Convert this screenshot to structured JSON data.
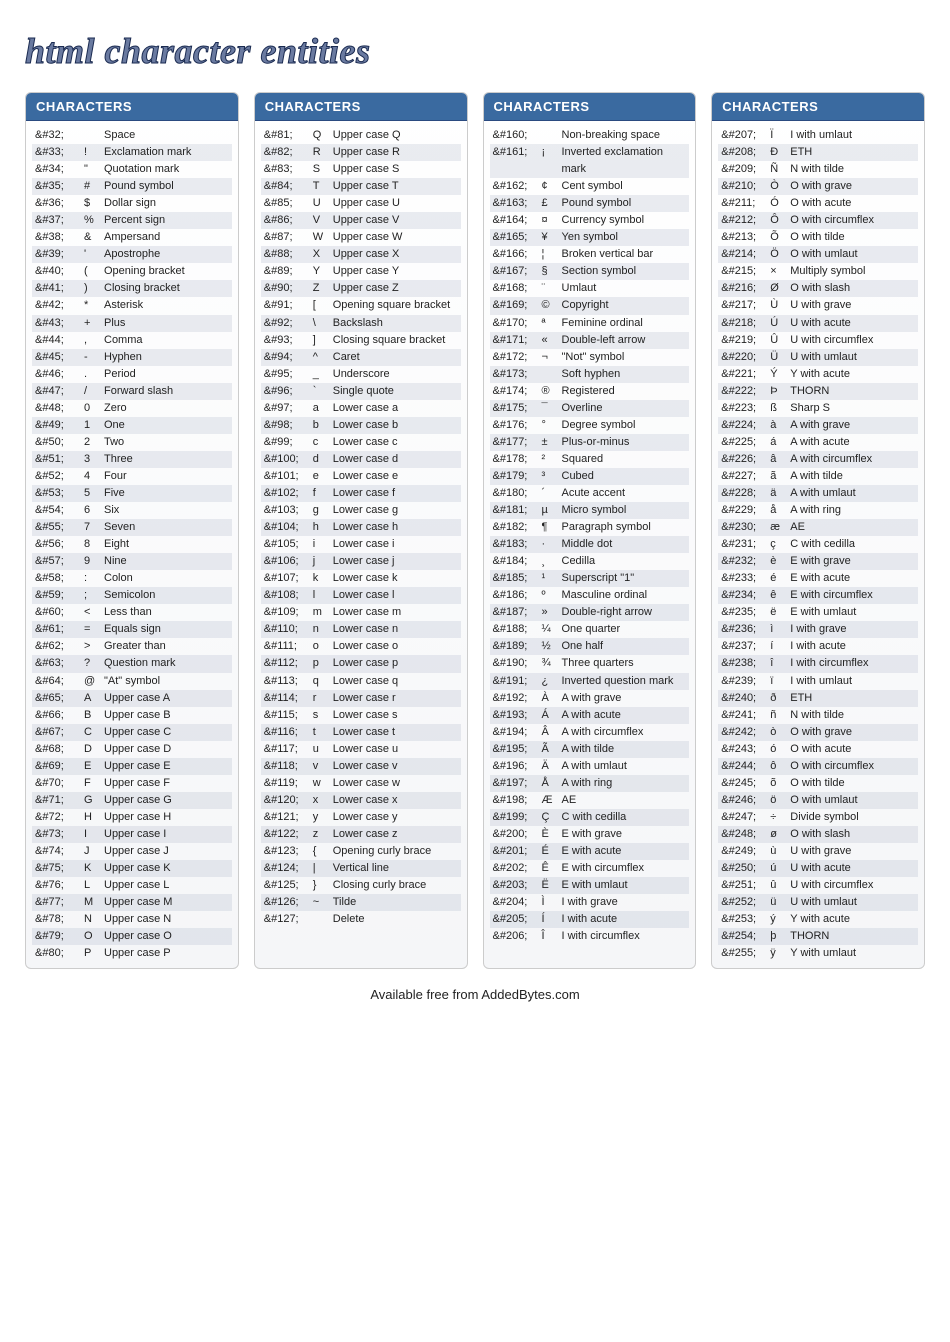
{
  "title": "html character entities",
  "col_header": "CHARACTERS",
  "footer": "Available free from AddedBytes.com",
  "columns": [
    [
      {
        "code": "&#32;",
        "char": " ",
        "desc": "Space"
      },
      {
        "code": "&#33;",
        "char": "!",
        "desc": "Exclamation mark"
      },
      {
        "code": "&#34;",
        "char": "\"",
        "desc": "Quotation mark"
      },
      {
        "code": "&#35;",
        "char": "#",
        "desc": "Pound symbol"
      },
      {
        "code": "&#36;",
        "char": "$",
        "desc": "Dollar sign"
      },
      {
        "code": "&#37;",
        "char": "%",
        "desc": "Percent sign"
      },
      {
        "code": "&#38;",
        "char": "&",
        "desc": "Ampersand"
      },
      {
        "code": "&#39;",
        "char": "'",
        "desc": "Apostrophe"
      },
      {
        "code": "&#40;",
        "char": "(",
        "desc": "Opening bracket"
      },
      {
        "code": "&#41;",
        "char": ")",
        "desc": "Closing bracket"
      },
      {
        "code": "&#42;",
        "char": "*",
        "desc": "Asterisk"
      },
      {
        "code": "&#43;",
        "char": "+",
        "desc": "Plus"
      },
      {
        "code": "&#44;",
        "char": ",",
        "desc": "Comma"
      },
      {
        "code": "&#45;",
        "char": "-",
        "desc": "Hyphen"
      },
      {
        "code": "&#46;",
        "char": ".",
        "desc": "Period"
      },
      {
        "code": "&#47;",
        "char": "/",
        "desc": "Forward slash"
      },
      {
        "code": "&#48;",
        "char": "0",
        "desc": "Zero"
      },
      {
        "code": "&#49;",
        "char": "1",
        "desc": "One"
      },
      {
        "code": "&#50;",
        "char": "2",
        "desc": "Two"
      },
      {
        "code": "&#51;",
        "char": "3",
        "desc": "Three"
      },
      {
        "code": "&#52;",
        "char": "4",
        "desc": "Four"
      },
      {
        "code": "&#53;",
        "char": "5",
        "desc": "Five"
      },
      {
        "code": "&#54;",
        "char": "6",
        "desc": "Six"
      },
      {
        "code": "&#55;",
        "char": "7",
        "desc": "Seven"
      },
      {
        "code": "&#56;",
        "char": "8",
        "desc": "Eight"
      },
      {
        "code": "&#57;",
        "char": "9",
        "desc": "Nine"
      },
      {
        "code": "&#58;",
        "char": ":",
        "desc": "Colon"
      },
      {
        "code": "&#59;",
        "char": ";",
        "desc": "Semicolon"
      },
      {
        "code": "&#60;",
        "char": "<",
        "desc": "Less than"
      },
      {
        "code": "&#61;",
        "char": "=",
        "desc": "Equals sign"
      },
      {
        "code": "&#62;",
        "char": ">",
        "desc": "Greater than"
      },
      {
        "code": "&#63;",
        "char": "?",
        "desc": "Question mark"
      },
      {
        "code": "&#64;",
        "char": "@",
        "desc": "\"At\" symbol"
      },
      {
        "code": "&#65;",
        "char": "A",
        "desc": "Upper case A"
      },
      {
        "code": "&#66;",
        "char": "B",
        "desc": "Upper case B"
      },
      {
        "code": "&#67;",
        "char": "C",
        "desc": "Upper case C"
      },
      {
        "code": "&#68;",
        "char": "D",
        "desc": "Upper case D"
      },
      {
        "code": "&#69;",
        "char": "E",
        "desc": "Upper case E"
      },
      {
        "code": "&#70;",
        "char": "F",
        "desc": "Upper case F"
      },
      {
        "code": "&#71;",
        "char": "G",
        "desc": "Upper case G"
      },
      {
        "code": "&#72;",
        "char": "H",
        "desc": "Upper case H"
      },
      {
        "code": "&#73;",
        "char": "I",
        "desc": "Upper case I"
      },
      {
        "code": "&#74;",
        "char": "J",
        "desc": "Upper case J"
      },
      {
        "code": "&#75;",
        "char": "K",
        "desc": "Upper case K"
      },
      {
        "code": "&#76;",
        "char": "L",
        "desc": "Upper case L"
      },
      {
        "code": "&#77;",
        "char": "M",
        "desc": "Upper case M"
      },
      {
        "code": "&#78;",
        "char": "N",
        "desc": "Upper case N"
      },
      {
        "code": "&#79;",
        "char": "O",
        "desc": "Upper case O"
      },
      {
        "code": "&#80;",
        "char": "P",
        "desc": "Upper case P"
      }
    ],
    [
      {
        "code": "&#81;",
        "char": "Q",
        "desc": "Upper case Q"
      },
      {
        "code": "&#82;",
        "char": "R",
        "desc": "Upper case R"
      },
      {
        "code": "&#83;",
        "char": "S",
        "desc": "Upper case S"
      },
      {
        "code": "&#84;",
        "char": "T",
        "desc": "Upper case T"
      },
      {
        "code": "&#85;",
        "char": "U",
        "desc": "Upper case U"
      },
      {
        "code": "&#86;",
        "char": "V",
        "desc": "Upper case V"
      },
      {
        "code": "&#87;",
        "char": "W",
        "desc": "Upper case W"
      },
      {
        "code": "&#88;",
        "char": "X",
        "desc": "Upper case X"
      },
      {
        "code": "&#89;",
        "char": "Y",
        "desc": "Upper case Y"
      },
      {
        "code": "&#90;",
        "char": "Z",
        "desc": "Upper case Z"
      },
      {
        "code": "&#91;",
        "char": "[",
        "desc": "Opening square bracket"
      },
      {
        "code": "&#92;",
        "char": "\\",
        "desc": "Backslash"
      },
      {
        "code": "&#93;",
        "char": "]",
        "desc": "Closing square bracket"
      },
      {
        "code": "&#94;",
        "char": "^",
        "desc": "Caret"
      },
      {
        "code": "&#95;",
        "char": "_",
        "desc": "Underscore"
      },
      {
        "code": "&#96;",
        "char": "`",
        "desc": "Single quote"
      },
      {
        "code": "&#97;",
        "char": "a",
        "desc": "Lower case a"
      },
      {
        "code": "&#98;",
        "char": "b",
        "desc": "Lower case b"
      },
      {
        "code": "&#99;",
        "char": "c",
        "desc": "Lower case c"
      },
      {
        "code": "&#100;",
        "char": "d",
        "desc": "Lower case d"
      },
      {
        "code": "&#101;",
        "char": "e",
        "desc": "Lower case e"
      },
      {
        "code": "&#102;",
        "char": "f",
        "desc": "Lower case f"
      },
      {
        "code": "&#103;",
        "char": "g",
        "desc": "Lower case g"
      },
      {
        "code": "&#104;",
        "char": "h",
        "desc": "Lower case h"
      },
      {
        "code": "&#105;",
        "char": "i",
        "desc": "Lower case i"
      },
      {
        "code": "&#106;",
        "char": "j",
        "desc": "Lower case j"
      },
      {
        "code": "&#107;",
        "char": "k",
        "desc": "Lower case k"
      },
      {
        "code": "&#108;",
        "char": "l",
        "desc": "Lower case l"
      },
      {
        "code": "&#109;",
        "char": "m",
        "desc": "Lower case m"
      },
      {
        "code": "&#110;",
        "char": "n",
        "desc": "Lower case n"
      },
      {
        "code": "&#111;",
        "char": "o",
        "desc": "Lower case o"
      },
      {
        "code": "&#112;",
        "char": "p",
        "desc": "Lower case p"
      },
      {
        "code": "&#113;",
        "char": "q",
        "desc": "Lower case q"
      },
      {
        "code": "&#114;",
        "char": "r",
        "desc": "Lower case r"
      },
      {
        "code": "&#115;",
        "char": "s",
        "desc": "Lower case s"
      },
      {
        "code": "&#116;",
        "char": "t",
        "desc": "Lower case t"
      },
      {
        "code": "&#117;",
        "char": "u",
        "desc": "Lower case u"
      },
      {
        "code": "&#118;",
        "char": "v",
        "desc": "Lower case v"
      },
      {
        "code": "&#119;",
        "char": "w",
        "desc": "Lower case w"
      },
      {
        "code": "&#120;",
        "char": "x",
        "desc": "Lower case x"
      },
      {
        "code": "&#121;",
        "char": "y",
        "desc": "Lower case y"
      },
      {
        "code": "&#122;",
        "char": "z",
        "desc": "Lower case z"
      },
      {
        "code": "&#123;",
        "char": "{",
        "desc": "Opening curly brace"
      },
      {
        "code": "&#124;",
        "char": "|",
        "desc": "Vertical line"
      },
      {
        "code": "&#125;",
        "char": "}",
        "desc": "Closing curly brace"
      },
      {
        "code": "&#126;",
        "char": "~",
        "desc": "Tilde"
      },
      {
        "code": "&#127;",
        "char": " ",
        "desc": "Delete"
      }
    ],
    [
      {
        "code": "&#160;",
        "char": " ",
        "desc": "Non-breaking space"
      },
      {
        "code": "&#161;",
        "char": "¡",
        "desc": "Inverted exclamation mark"
      },
      {
        "code": "&#162;",
        "char": "¢",
        "desc": "Cent symbol"
      },
      {
        "code": "&#163;",
        "char": "£",
        "desc": "Pound symbol"
      },
      {
        "code": "&#164;",
        "char": "¤",
        "desc": "Currency symbol"
      },
      {
        "code": "&#165;",
        "char": "¥",
        "desc": "Yen symbol"
      },
      {
        "code": "&#166;",
        "char": "¦",
        "desc": "Broken vertical bar"
      },
      {
        "code": "&#167;",
        "char": "§",
        "desc": "Section symbol"
      },
      {
        "code": "&#168;",
        "char": "¨",
        "desc": "Umlaut"
      },
      {
        "code": "&#169;",
        "char": "©",
        "desc": "Copyright"
      },
      {
        "code": "&#170;",
        "char": "ª",
        "desc": "Feminine ordinal"
      },
      {
        "code": "&#171;",
        "char": "«",
        "desc": "Double-left arrow"
      },
      {
        "code": "&#172;",
        "char": "¬",
        "desc": "\"Not\" symbol"
      },
      {
        "code": "&#173;",
        "char": " ",
        "desc": "Soft hyphen"
      },
      {
        "code": "&#174;",
        "char": "®",
        "desc": "Registered"
      },
      {
        "code": "&#175;",
        "char": "¯",
        "desc": "Overline"
      },
      {
        "code": "&#176;",
        "char": "°",
        "desc": "Degree symbol"
      },
      {
        "code": "&#177;",
        "char": "±",
        "desc": "Plus-or-minus"
      },
      {
        "code": "&#178;",
        "char": "²",
        "desc": "Squared"
      },
      {
        "code": "&#179;",
        "char": "³",
        "desc": "Cubed"
      },
      {
        "code": "&#180;",
        "char": "´",
        "desc": "Acute accent"
      },
      {
        "code": "&#181;",
        "char": "µ",
        "desc": "Micro symbol"
      },
      {
        "code": "&#182;",
        "char": "¶",
        "desc": "Paragraph symbol"
      },
      {
        "code": "&#183;",
        "char": "·",
        "desc": "Middle dot"
      },
      {
        "code": "&#184;",
        "char": "¸",
        "desc": "Cedilla"
      },
      {
        "code": "&#185;",
        "char": "¹",
        "desc": "Superscript \"1\""
      },
      {
        "code": "&#186;",
        "char": "º",
        "desc": "Masculine ordinal"
      },
      {
        "code": "&#187;",
        "char": "»",
        "desc": "Double-right arrow"
      },
      {
        "code": "&#188;",
        "char": "¼",
        "desc": "One quarter"
      },
      {
        "code": "&#189;",
        "char": "½",
        "desc": "One half"
      },
      {
        "code": "&#190;",
        "char": "¾",
        "desc": "Three quarters"
      },
      {
        "code": "&#191;",
        "char": "¿",
        "desc": "Inverted question mark"
      },
      {
        "code": "&#192;",
        "char": "À",
        "desc": "A with grave"
      },
      {
        "code": "&#193;",
        "char": "Á",
        "desc": "A with acute"
      },
      {
        "code": "&#194;",
        "char": "Â",
        "desc": "A with circumflex"
      },
      {
        "code": "&#195;",
        "char": "Ã",
        "desc": "A with tilde"
      },
      {
        "code": "&#196;",
        "char": "Ä",
        "desc": "A with umlaut"
      },
      {
        "code": "&#197;",
        "char": "Å",
        "desc": "A with ring"
      },
      {
        "code": "&#198;",
        "char": "Æ",
        "desc": "AE"
      },
      {
        "code": "&#199;",
        "char": "Ç",
        "desc": "C with cedilla"
      },
      {
        "code": "&#200;",
        "char": "È",
        "desc": "E with grave"
      },
      {
        "code": "&#201;",
        "char": "É",
        "desc": "E with acute"
      },
      {
        "code": "&#202;",
        "char": "Ê",
        "desc": "E with circumflex"
      },
      {
        "code": "&#203;",
        "char": "Ë",
        "desc": "E with umlaut"
      },
      {
        "code": "&#204;",
        "char": "Ì",
        "desc": "I with grave"
      },
      {
        "code": "&#205;",
        "char": "Í",
        "desc": "I with acute"
      },
      {
        "code": "&#206;",
        "char": "Î",
        "desc": "I with circumflex"
      }
    ],
    [
      {
        "code": "&#207;",
        "char": "Ï",
        "desc": "I with umlaut"
      },
      {
        "code": "&#208;",
        "char": "Ð",
        "desc": "ETH"
      },
      {
        "code": "&#209;",
        "char": "Ñ",
        "desc": "N with tilde"
      },
      {
        "code": "&#210;",
        "char": "Ò",
        "desc": "O with grave"
      },
      {
        "code": "&#211;",
        "char": "Ó",
        "desc": "O with acute"
      },
      {
        "code": "&#212;",
        "char": "Ô",
        "desc": "O with circumflex"
      },
      {
        "code": "&#213;",
        "char": "Õ",
        "desc": "O with tilde"
      },
      {
        "code": "&#214;",
        "char": "Ö",
        "desc": "O with umlaut"
      },
      {
        "code": "&#215;",
        "char": "×",
        "desc": "Multiply symbol"
      },
      {
        "code": "&#216;",
        "char": "Ø",
        "desc": "O with slash"
      },
      {
        "code": "&#217;",
        "char": "Ù",
        "desc": "U with grave"
      },
      {
        "code": "&#218;",
        "char": "Ú",
        "desc": "U with acute"
      },
      {
        "code": "&#219;",
        "char": "Û",
        "desc": "U with circumflex"
      },
      {
        "code": "&#220;",
        "char": "Ü",
        "desc": "U with umlaut"
      },
      {
        "code": "&#221;",
        "char": "Ý",
        "desc": "Y with acute"
      },
      {
        "code": "&#222;",
        "char": "Þ",
        "desc": "THORN"
      },
      {
        "code": "&#223;",
        "char": "ß",
        "desc": "Sharp S"
      },
      {
        "code": "&#224;",
        "char": "à",
        "desc": "A with grave"
      },
      {
        "code": "&#225;",
        "char": "á",
        "desc": "A with acute"
      },
      {
        "code": "&#226;",
        "char": "â",
        "desc": "A with circumflex"
      },
      {
        "code": "&#227;",
        "char": "ã",
        "desc": "A with tilde"
      },
      {
        "code": "&#228;",
        "char": "ä",
        "desc": "A with umlaut"
      },
      {
        "code": "&#229;",
        "char": "å",
        "desc": "A with ring"
      },
      {
        "code": "&#230;",
        "char": "æ",
        "desc": "AE"
      },
      {
        "code": "&#231;",
        "char": "ç",
        "desc": "C with cedilla"
      },
      {
        "code": "&#232;",
        "char": "è",
        "desc": "E with grave"
      },
      {
        "code": "&#233;",
        "char": "é",
        "desc": "E with acute"
      },
      {
        "code": "&#234;",
        "char": "ê",
        "desc": "E with circumflex"
      },
      {
        "code": "&#235;",
        "char": "ë",
        "desc": "E with umlaut"
      },
      {
        "code": "&#236;",
        "char": "ì",
        "desc": "I with grave"
      },
      {
        "code": "&#237;",
        "char": "í",
        "desc": "I with acute"
      },
      {
        "code": "&#238;",
        "char": "î",
        "desc": "I with circumflex"
      },
      {
        "code": "&#239;",
        "char": "ï",
        "desc": "I with umlaut"
      },
      {
        "code": "&#240;",
        "char": "ð",
        "desc": "ETH"
      },
      {
        "code": "&#241;",
        "char": "ñ",
        "desc": "N with tilde"
      },
      {
        "code": "&#242;",
        "char": "ò",
        "desc": "O with grave"
      },
      {
        "code": "&#243;",
        "char": "ó",
        "desc": "O with acute"
      },
      {
        "code": "&#244;",
        "char": "ô",
        "desc": "O with circumflex"
      },
      {
        "code": "&#245;",
        "char": "õ",
        "desc": "O with tilde"
      },
      {
        "code": "&#246;",
        "char": "ö",
        "desc": "O with umlaut"
      },
      {
        "code": "&#247;",
        "char": "÷",
        "desc": "Divide symbol"
      },
      {
        "code": "&#248;",
        "char": "ø",
        "desc": "O with slash"
      },
      {
        "code": "&#249;",
        "char": "ù",
        "desc": "U with grave"
      },
      {
        "code": "&#250;",
        "char": "ú",
        "desc": "U with acute"
      },
      {
        "code": "&#251;",
        "char": "û",
        "desc": "U with circumflex"
      },
      {
        "code": "&#252;",
        "char": "ü",
        "desc": "U with umlaut"
      },
      {
        "code": "&#253;",
        "char": "ý",
        "desc": "Y with acute"
      },
      {
        "code": "&#254;",
        "char": "þ",
        "desc": "THORN"
      },
      {
        "code": "&#255;",
        "char": "ÿ",
        "desc": "Y with umlaut"
      }
    ]
  ]
}
